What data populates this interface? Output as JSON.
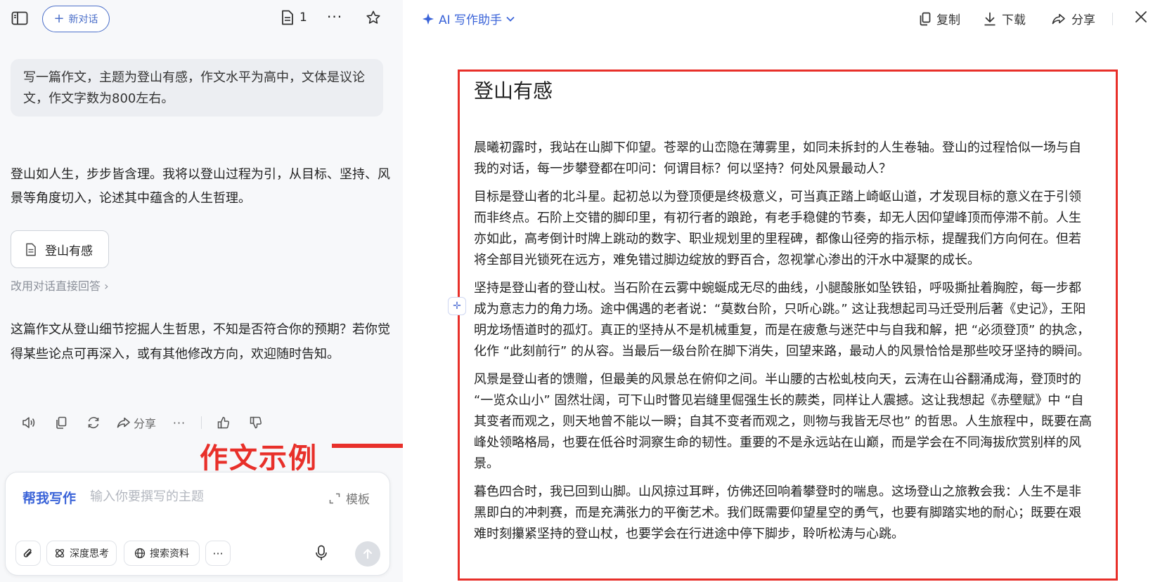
{
  "left": {
    "new_chat_label": "新对话",
    "doc_count": "1",
    "prompt": "写一篇作文，主题为登山有感，作文水平为高中，文体是议论文，作文字数为800左右。",
    "reply_intro": "登山如人生，步步皆含理。我将以登山过程为引，从目标、坚持、风景等角度切入，论述其中蕴含的人生哲理。",
    "doc_card_title": "登山有感",
    "switch_link": "改用对话直接回答 ›",
    "reply_outro": "这篇作文从登山细节挖掘人生哲思，不知是否符合你的预期？若你觉得某些论点可再深入，或有其他修改方向，欢迎随时告知。",
    "share_label": "分享",
    "annotation": "作文示例"
  },
  "composer": {
    "mode_label": "帮我写作",
    "placeholder": "输入你要撰写的主题",
    "template_label": "模板",
    "tools": [
      "深度思考",
      "搜索资料"
    ]
  },
  "right": {
    "assistant_label": "AI 写作助手",
    "copy_label": "复制",
    "download_label": "下载",
    "share_label": "分享"
  },
  "essay": {
    "title": "登山有感",
    "paragraphs": [
      "晨曦初露时，我站在山脚下仰望。苍翠的山峦隐在薄雾里，如同未拆封的人生卷轴。登山的过程恰似一场与自我的对话，每一步攀登都在叩问：何谓目标？何以坚持？何处风景最动人？",
      "目标是登山者的北斗星。起初总以为登顶便是终极意义，可当真正踏上崎岖山道，才发现目标的意义在于引领而非终点。石阶上交错的脚印里，有初行者的踉跄，有老手稳健的节奏，却无人因仰望峰顶而停滞不前。人生亦如此，高考倒计时牌上跳动的数字、职业规划里的里程碑，都像山径旁的指示标，提醒我们方向何在。但若将全部目光锁死在远方，难免错过脚边绽放的野百合，忽视掌心渗出的汗水中凝聚的成长。",
      "坚持是登山者的登山杖。当石阶在云雾中蜿蜒成无尽的曲线，小腿酸胀如坠铁铅，呼吸撕扯着胸腔，每一步都成为意志力的角力场。途中偶遇的老者说：“莫数台阶，只听心跳。” 这让我想起司马迁受刑后著《史记》，王阳明龙场悟道时的孤灯。真正的坚持从不是机械重复，而是在疲惫与迷茫中与自我和解，把 “必须登顶” 的执念，化作 “此刻前行” 的从容。当最后一级台阶在脚下消失，回望来路，最动人的风景恰恰是那些咬牙坚持的瞬间。",
      "风景是登山者的馈赠，但最美的风景总在俯仰之间。半山腰的古松虬枝向天，云涛在山谷翻涌成海，登顶时的 “一览众山小” 固然壮阔，可下山时瞥见岩缝里倔强生长的蕨类，同样让人震撼。这让我想起《赤壁赋》中 “自其变者而观之，则天地曾不能以一瞬；自其不变者而观之，则物与我皆无尽也” 的哲思。人生旅程中，既要在高峰处领略格局，也要在低谷时洞察生命的韧性。重要的不是永远站在山巅，而是学会在不同海拔欣赏别样的风景。",
      "暮色四合时，我已回到山脚。山风掠过耳畔，仿佛还回响着攀登时的喘息。这场登山之旅教会我：人生不是非黑即白的冲刺赛，而是充满张力的平衡艺术。我们既需要仰望星空的勇气，也要有脚踏实地的耐心；既要在艰难时刻攥紧坚持的登山杖，也要学会在行进途中停下脚步，聆听松涛与心跳。"
    ]
  },
  "colors": {
    "accent": "#3a63d8",
    "annotation_red": "#e8302a",
    "left_bg": "#f7f8fa"
  }
}
